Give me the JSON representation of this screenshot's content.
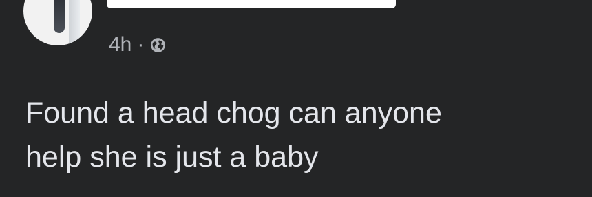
{
  "post": {
    "timestamp": "4h",
    "separator": "·",
    "privacy_icon": "globe-icon",
    "text": "Found a head chog can anyone\nhelp she is just a baby"
  },
  "colors": {
    "background": "#242526",
    "primary_text": "#e4e6eb",
    "secondary_text": "#b0b3b8",
    "redaction": "#ffffff"
  }
}
